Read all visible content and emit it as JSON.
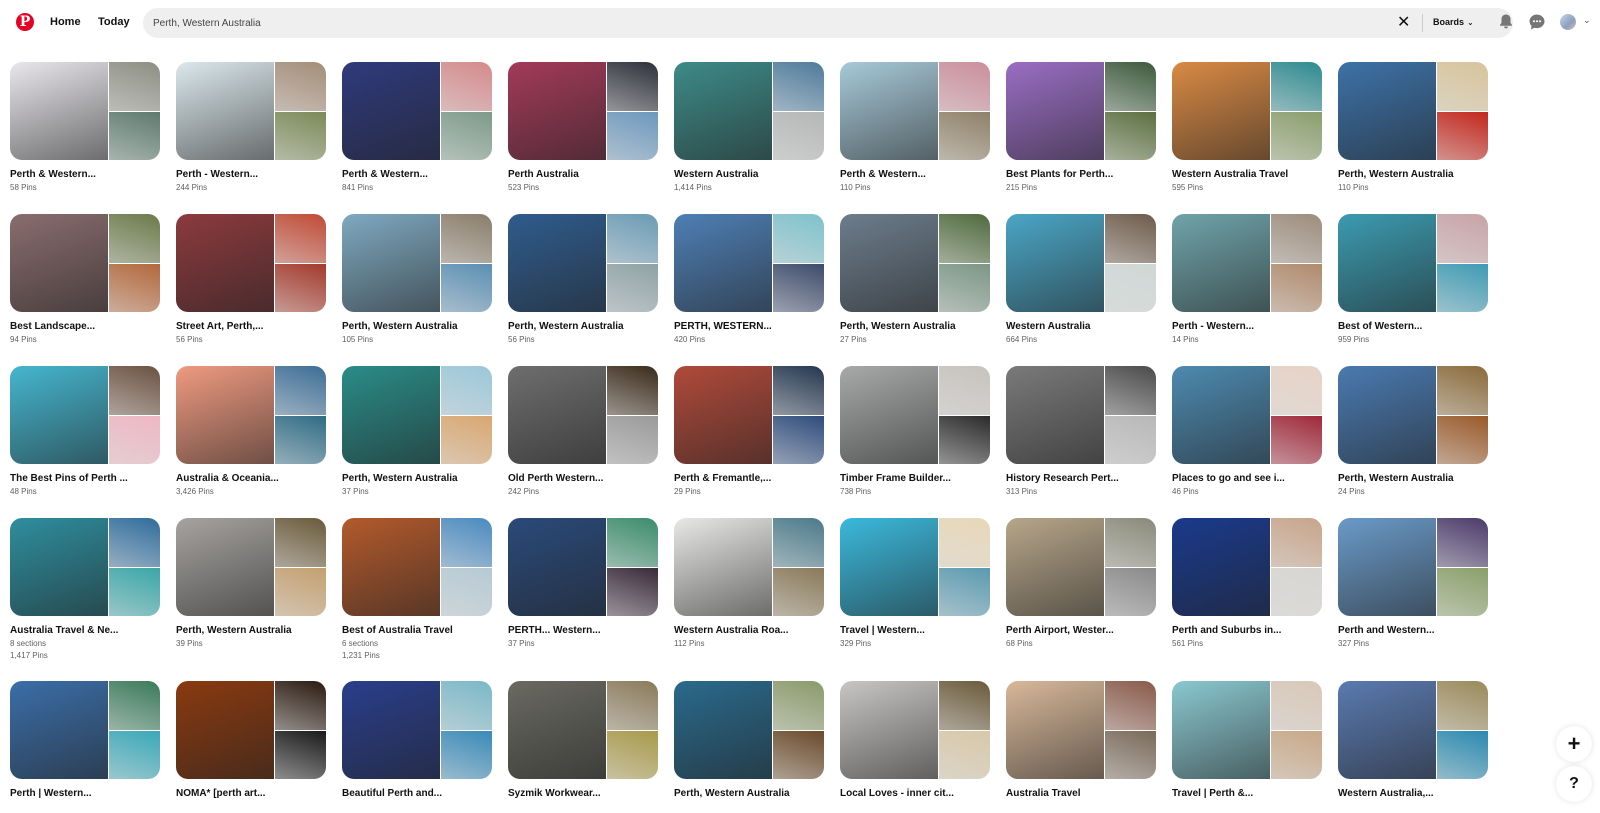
{
  "header": {
    "logo": "P",
    "nav": [
      "Home",
      "Today"
    ],
    "search_value": "Perth, Western Australia",
    "clear_icon": "✕",
    "scope_label": "Boards",
    "icons": [
      "bell-icon",
      "chat-icon",
      "avatar",
      "account-chevron"
    ]
  },
  "boards": [
    {
      "title": "Perth & Western...",
      "subs": [
        "58 Pins"
      ],
      "colors": [
        "#e9e7ec",
        "#8d8f83",
        "#5d7a6d"
      ]
    },
    {
      "title": "Perth - Western...",
      "subs": [
        "244 Pins"
      ],
      "colors": [
        "#dbe8ec",
        "#a48d78",
        "#7b8a58"
      ]
    },
    {
      "title": "Perth & Western...",
      "subs": [
        "841 Pins"
      ],
      "colors": [
        "#2f3a7c",
        "#d58a8c",
        "#7c9a89"
      ]
    },
    {
      "title": "Perth Australia",
      "subs": [
        "523 Pins"
      ],
      "colors": [
        "#a33a59",
        "#2d2f3a",
        "#6c98bd"
      ]
    },
    {
      "title": "Western Australia",
      "subs": [
        "1,414 Pins"
      ],
      "colors": [
        "#3d8b88",
        "#4d7b9c",
        "#b5b7b6"
      ]
    },
    {
      "title": "Perth & Western...",
      "subs": [
        "110 Pins"
      ],
      "colors": [
        "#a7c9d8",
        "#cb8e9c",
        "#8f8168"
      ]
    },
    {
      "title": "Best Plants for Perth...",
      "subs": [
        "215 Pins"
      ],
      "colors": [
        "#9a6ec4",
        "#3c5a3c",
        "#5c7040"
      ]
    },
    {
      "title": "Western Australia Travel",
      "subs": [
        "595 Pins"
      ],
      "colors": [
        "#d98a44",
        "#2d8a90",
        "#8a9e6c"
      ]
    },
    {
      "title": "Perth, Western Australia",
      "subs": [
        "110 Pins"
      ],
      "colors": [
        "#3d72a8",
        "#d8c49a",
        "#c3271d"
      ]
    },
    {
      "title": "Best Landscape...",
      "subs": [
        "94 Pins"
      ],
      "colors": [
        "#8a6d6e",
        "#6b7a4a",
        "#b3683c"
      ]
    },
    {
      "title": "Street Art, Perth,...",
      "subs": [
        "56 Pins"
      ],
      "colors": [
        "#8c3a3e",
        "#c04a35",
        "#a43a2c"
      ]
    },
    {
      "title": "Perth, Western Australia",
      "subs": [
        "105 Pins"
      ],
      "colors": [
        "#7fa9c0",
        "#8a7d6a",
        "#5b8fb3"
      ]
    },
    {
      "title": "Perth, Western Australia",
      "subs": [
        "56 Pins"
      ],
      "colors": [
        "#2f5c8d",
        "#6a9bb5",
        "#8fa2a6"
      ]
    },
    {
      "title": "PERTH, WESTERN...",
      "subs": [
        "420 Pins"
      ],
      "colors": [
        "#4e7fb5",
        "#7fc2cc",
        "#3d4b6b"
      ]
    },
    {
      "title": "Perth, Western Australia",
      "subs": [
        "27 Pins"
      ],
      "colors": [
        "#6d7d8c",
        "#4f6a3d",
        "#7c9686"
      ]
    },
    {
      "title": "Western Australia",
      "subs": [
        "664 Pins"
      ],
      "colors": [
        "#4aa6c6",
        "#6d5b4a",
        "#cfd8d6"
      ]
    },
    {
      "title": "Perth - Western...",
      "subs": [
        "14 Pins"
      ],
      "colors": [
        "#6fa4aa",
        "#9c8c7c",
        "#b08a6c"
      ]
    },
    {
      "title": "Best of Western...",
      "subs": [
        "959 Pins"
      ],
      "colors": [
        "#3b9bb0",
        "#c8a3a6",
        "#3e9bb4"
      ]
    },
    {
      "title": "The Best Pins of Perth ...",
      "subs": [
        "48 Pins"
      ],
      "colors": [
        "#45b6cf",
        "#6b5140",
        "#efb7c4"
      ]
    },
    {
      "title": "Australia & Oceania...",
      "subs": [
        "3,426 Pins"
      ],
      "colors": [
        "#ef9a80",
        "#3c6d96",
        "#2f6c86"
      ]
    },
    {
      "title": "Perth, Western Australia",
      "subs": [
        "37 Pins"
      ],
      "colors": [
        "#2a8c88",
        "#9bc7d9",
        "#d9a770"
      ]
    },
    {
      "title": "Old Perth Western...",
      "subs": [
        "242 Pins"
      ],
      "colors": [
        "#6e6e6e",
        "#3a2a1a",
        "#9a9a9a"
      ]
    },
    {
      "title": "Perth & Fremantle,...",
      "subs": [
        "29 Pins"
      ],
      "colors": [
        "#b04a3a",
        "#24364f",
        "#2f4c7c"
      ]
    },
    {
      "title": "Timber Frame Builder...",
      "subs": [
        "738 Pins"
      ],
      "colors": [
        "#a8aaaa",
        "#c7c3be",
        "#2b2b2b"
      ]
    },
    {
      "title": "History Research Pert...",
      "subs": [
        "313 Pins"
      ],
      "colors": [
        "#7a7a7a",
        "#4a4a4a",
        "#b8b8b8"
      ]
    },
    {
      "title": "Places to go and see i...",
      "subs": [
        "46 Pins"
      ],
      "colors": [
        "#4d8ab0",
        "#e7d3c6",
        "#a0283a"
      ]
    },
    {
      "title": "Perth, Western Australia",
      "subs": [
        "24 Pins"
      ],
      "colors": [
        "#4a7ab0",
        "#8a6a3a",
        "#9a5a2a"
      ]
    },
    {
      "title": "Australia Travel & Ne...",
      "subs": [
        "8 sections",
        "1,417 Pins"
      ],
      "colors": [
        "#2e8e9e",
        "#2f6c9c",
        "#3aa6a8"
      ]
    },
    {
      "title": "Perth, Western Australia",
      "subs": [
        "39 Pins"
      ],
      "colors": [
        "#a6a3a0",
        "#6a5a3a",
        "#c4a070"
      ]
    },
    {
      "title": "Best of Australia Travel",
      "subs": [
        "6 sections",
        "1,231 Pins"
      ],
      "colors": [
        "#b35a2c",
        "#4a8ac0",
        "#b6cad4"
      ]
    },
    {
      "title": "PERTH... Western...",
      "subs": [
        "37 Pins"
      ],
      "colors": [
        "#2a4a7a",
        "#3a8c6c",
        "#3a2a3a"
      ]
    },
    {
      "title": "Western Australia Roa...",
      "subs": [
        "112 Pins"
      ],
      "colors": [
        "#e8e8e6",
        "#4a7a8a",
        "#8a7a5a"
      ]
    },
    {
      "title": "Travel | Western...",
      "subs": [
        "329 Pins"
      ],
      "colors": [
        "#3bb9dc",
        "#e8d8b8",
        "#5a9ab0"
      ]
    },
    {
      "title": "Perth Airport, Wester...",
      "subs": [
        "68 Pins"
      ],
      "colors": [
        "#b7a68a",
        "#8a8a7a",
        "#8a8a8a"
      ]
    },
    {
      "title": "Perth and Suburbs in...",
      "subs": [
        "561 Pins"
      ],
      "colors": [
        "#1a3a8c",
        "#c8a48a",
        "#d8d6d2"
      ]
    },
    {
      "title": "Perth and Western...",
      "subs": [
        "327 Pins"
      ],
      "colors": [
        "#6a9ac8",
        "#4a3a6a",
        "#8aa06a"
      ]
    },
    {
      "title": "Perth | Western...",
      "subs": [],
      "colors": [
        "#3b6ea8",
        "#3a7a5a",
        "#3aa8b8"
      ]
    },
    {
      "title": "NOMA* [perth art...",
      "subs": [],
      "colors": [
        "#8a3a10",
        "#2a1a10",
        "#1a1a1a"
      ]
    },
    {
      "title": "Beautiful Perth and...",
      "subs": [],
      "colors": [
        "#2a3e8c",
        "#7ab8c8",
        "#3a8ab8"
      ]
    },
    {
      "title": "Syzmik Workwear...",
      "subs": [],
      "colors": [
        "#6a6a62",
        "#8a7a5a",
        "#a89a4a"
      ]
    },
    {
      "title": "Perth, Western Australia",
      "subs": [],
      "colors": [
        "#2a6a8c",
        "#8a9a6a",
        "#6a4a2a"
      ]
    },
    {
      "title": "Local Loves - inner cit...",
      "subs": [],
      "colors": [
        "#c8c6c4",
        "#6a5a3a",
        "#d8c8a8"
      ]
    },
    {
      "title": "Australia Travel",
      "subs": [],
      "colors": [
        "#d8b89a",
        "#8a5a4a",
        "#7a6a5a"
      ]
    },
    {
      "title": "Travel | Perth &...",
      "subs": [],
      "colors": [
        "#8ac8d0",
        "#d8c8b8",
        "#c8a888"
      ]
    },
    {
      "title": "Western Australia,...",
      "subs": [],
      "colors": [
        "#5a7ab0",
        "#9a8a5a",
        "#2a8ab0"
      ]
    }
  ],
  "fab": {
    "add": "+",
    "help": "?"
  }
}
